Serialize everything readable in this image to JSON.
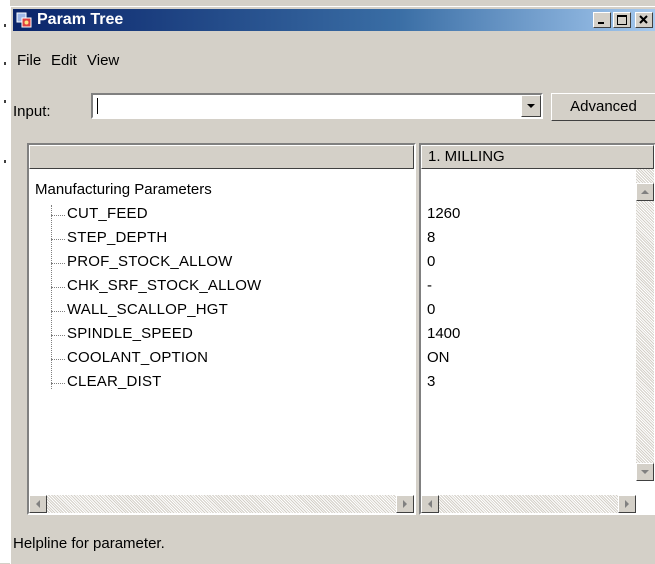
{
  "window": {
    "title": "Param Tree",
    "icon": "app-icon"
  },
  "menu": {
    "items": [
      "File",
      "Edit",
      "View"
    ]
  },
  "input": {
    "label": "Input:",
    "value": ""
  },
  "advanced_button": "Advanced",
  "left_pane": {
    "header": "",
    "root": "Manufacturing Parameters",
    "params": [
      "CUT_FEED",
      "STEP_DEPTH",
      "PROF_STOCK_ALLOW",
      "CHK_SRF_STOCK_ALLOW",
      "WALL_SCALLOP_HGT",
      "SPINDLE_SPEED",
      "COOLANT_OPTION",
      "CLEAR_DIST"
    ]
  },
  "right_pane": {
    "header": "1. MILLING",
    "values": [
      "1260",
      "8",
      "0",
      "-",
      "0",
      "1400",
      "ON",
      "3"
    ]
  },
  "status": "Helpline for parameter.",
  "colors": {
    "title_start": "#0a246a",
    "title_end": "#a6caf0",
    "face": "#d4d0c8"
  }
}
